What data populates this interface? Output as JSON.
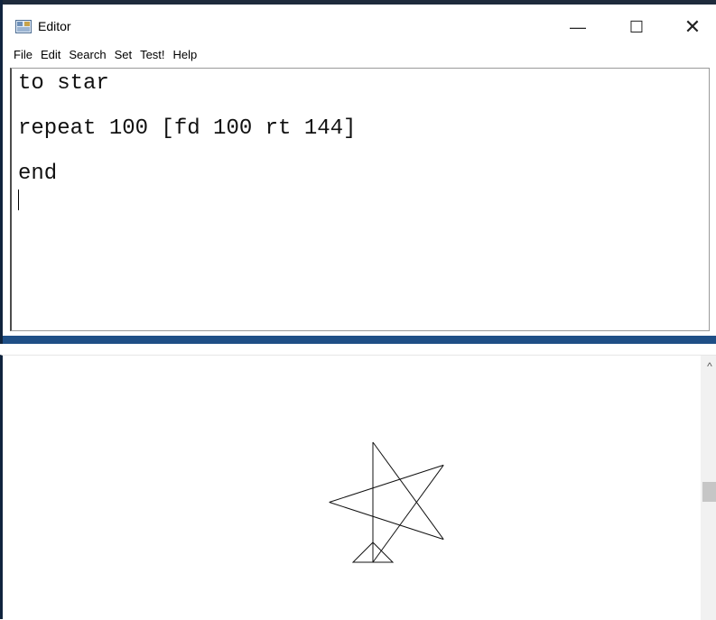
{
  "editor": {
    "title": "Editor",
    "controls": {
      "minimize": "—",
      "maximize": "☐",
      "close": "✕"
    },
    "menu": [
      "File",
      "Edit",
      "Search",
      "Set",
      "Test!",
      "Help"
    ],
    "code_lines": [
      "to star",
      "repeat 100 [fd 100 rt 144]",
      "end"
    ]
  },
  "graphics": {
    "scroll_up": "^",
    "turtle": {
      "heading": 0,
      "step": 100,
      "turn": 144
    }
  }
}
